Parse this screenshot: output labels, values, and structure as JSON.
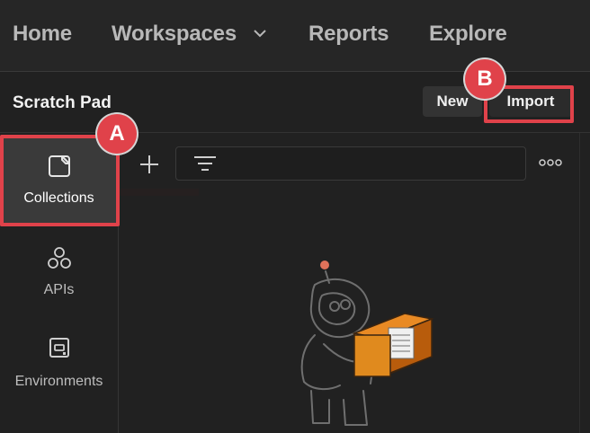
{
  "topnav": {
    "home": "Home",
    "workspaces": "Workspaces",
    "reports": "Reports",
    "explore": "Explore"
  },
  "workspace": {
    "title": "Scratch Pad",
    "new_label": "New",
    "import_label": "Import"
  },
  "sidebar": {
    "items": [
      {
        "label": "Collections",
        "icon": "collections-icon",
        "active": true
      },
      {
        "label": "APIs",
        "icon": "apis-icon"
      },
      {
        "label": "Environments",
        "icon": "environments-icon"
      }
    ]
  },
  "annotations": {
    "a": "A",
    "b": "B"
  },
  "colors": {
    "accent": "#e0424a",
    "background": "#212121",
    "illustration_orange": "#e07b1a"
  }
}
